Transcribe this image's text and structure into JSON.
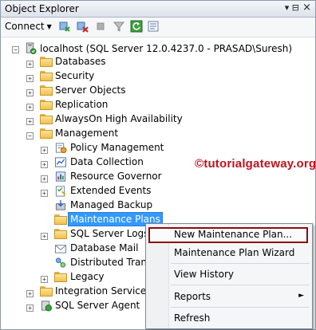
{
  "window": {
    "title": "Object Explorer",
    "pin_glyph": "▾ ⊟",
    "close_glyph": "×"
  },
  "toolbar": {
    "connect_label": "Connect",
    "icons": [
      "connect-icon",
      "disconnect-icon",
      "stop-icon",
      "filter-icon",
      "refresh-icon",
      "summary-icon"
    ]
  },
  "tree": {
    "root": "localhost (SQL Server 12.0.4237.0 - PRASAD\\Suresh)",
    "nodes": {
      "databases": "Databases",
      "security": "Security",
      "server_objects": "Server Objects",
      "replication": "Replication",
      "alwayson": "AlwaysOn High Availability",
      "management": "Management",
      "policy_management": "Policy Management",
      "data_collection": "Data Collection",
      "resource_governor": "Resource Governor",
      "extended_events": "Extended Events",
      "managed_backup": "Managed Backup",
      "maintenance_plans": "Maintenance Plans",
      "sql_server_logs": "SQL Server Logs",
      "database_mail": "Database Mail",
      "distributed_transa": "Distributed Transa",
      "legacy": "Legacy",
      "integration_services": "Integration Services C",
      "sql_server_agent": "SQL Server Agent"
    },
    "expand_plus": "+",
    "expand_minus": "−"
  },
  "watermark": "©tutorialgateway.org",
  "context_menu": {
    "items": [
      {
        "label": "New Maintenance Plan...",
        "highlighted": true
      },
      {
        "label": "Maintenance Plan Wizard"
      },
      {
        "label": "View History"
      },
      {
        "label": "Reports",
        "submenu": true
      },
      {
        "label": "Refresh"
      }
    ],
    "submenu_arrow": "►"
  },
  "colors": {
    "selection": "#3399ff",
    "highlight_border": "#8b0d10",
    "watermark": "#c2111b"
  }
}
